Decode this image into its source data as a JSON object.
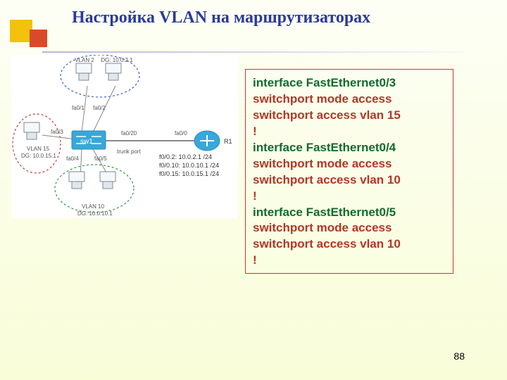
{
  "title": "Настройка VLAN на маршрутизаторах",
  "page_number": "88",
  "diagram": {
    "vlan2": {
      "name": "VLAN 2",
      "dg": "DG: 10.0.2.1"
    },
    "vlan15": {
      "name": "VLAN 15",
      "dg": "DG: 10.0.15.1"
    },
    "vlan10": {
      "name": "VLAN 10",
      "dg": "DG: 10.0.10.1"
    },
    "sw_name": "sw1",
    "router": "R1",
    "trunk": "trunk port",
    "ports": {
      "p01": "fa0/1",
      "p02": "fa0/2",
      "p03": "fa0/3",
      "p04": "fa0/4",
      "p05": "fa0/5",
      "p020": "fa0/20",
      "rp": "fa0/0"
    },
    "sub": {
      "s1": "f0/0.2:  10.0.2.1 /24",
      "s2": "f0/0.10: 10.0.10.1 /24",
      "s3": "f0/0.15: 10.0.15.1 /24"
    }
  },
  "config_lines": [
    {
      "text": "interface FastEthernet0/3",
      "cls": "g"
    },
    {
      "text": " switchport mode access",
      "cls": "r"
    },
    {
      "text": " switchport access vlan 15",
      "cls": "r"
    },
    {
      "text": "!",
      "cls": "r"
    },
    {
      "text": "interface FastEthernet0/4",
      "cls": "g"
    },
    {
      "text": " switchport mode access",
      "cls": "r"
    },
    {
      "text": " switchport access vlan 10",
      "cls": "r"
    },
    {
      "text": "!",
      "cls": "r"
    },
    {
      "text": "interface FastEthernet0/5",
      "cls": "g"
    },
    {
      "text": " switchport mode access",
      "cls": "r"
    },
    {
      "text": " switchport access vlan 10",
      "cls": "r"
    },
    {
      "text": "!",
      "cls": "r"
    }
  ]
}
